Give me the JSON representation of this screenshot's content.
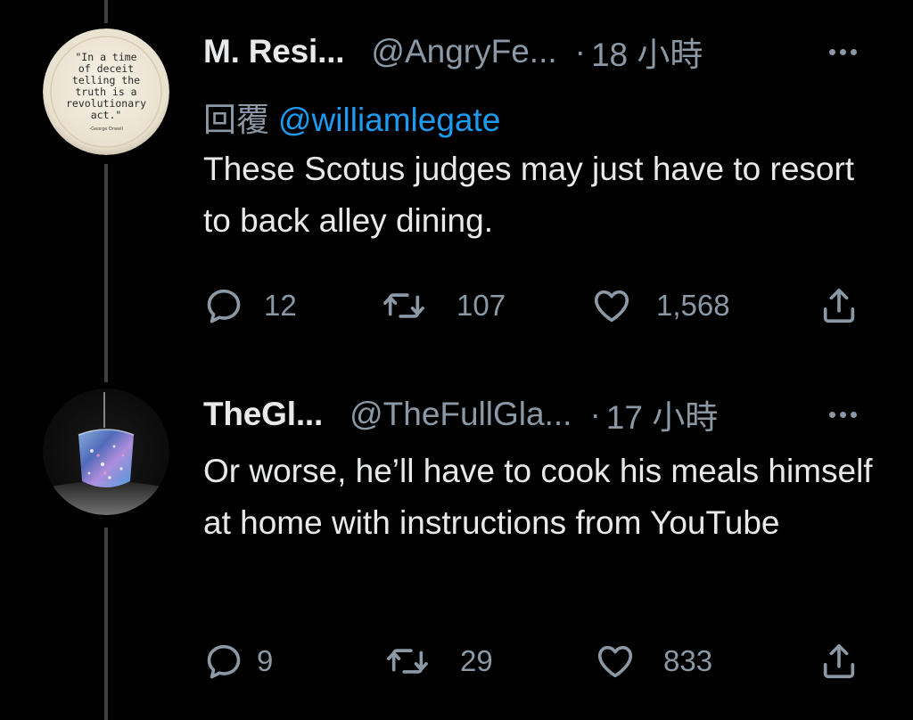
{
  "tweets": [
    {
      "display_name": "M. Resi...",
      "handle": "@AngryFe...",
      "separator": "·",
      "time": "18 小時",
      "reply_prefix": "回覆",
      "reply_mention": "@williamlegate",
      "text": "These Scotus judges may just have to resort to back alley dining.",
      "avatar": {
        "quote_lines": [
          "\"In a time",
          "of deceit",
          "telling the",
          "truth is a",
          "revolutionary",
          "act.\""
        ],
        "attribution": "-George Orwell"
      },
      "actions": {
        "reply_count": "12",
        "retweet_count": "107",
        "like_count": "1,568"
      }
    },
    {
      "display_name": "TheGl...",
      "handle": "@TheFullGla...",
      "separator": "·",
      "time": "17 小時",
      "text": "Or worse, he’ll have to cook his meals himself at home with instructions from YouTube",
      "actions": {
        "reply_count": "9",
        "retweet_count": "29",
        "like_count": "833"
      }
    }
  ],
  "icons": {
    "reply": "reply-icon",
    "retweet": "retweet-icon",
    "like": "heart-icon",
    "share": "share-icon",
    "more": "more-icon"
  },
  "colors": {
    "background": "#000000",
    "text": "#e7e9ea",
    "secondary": "#8b98a5",
    "link": "#1d9bf0",
    "thread_line": "#3e4144"
  }
}
